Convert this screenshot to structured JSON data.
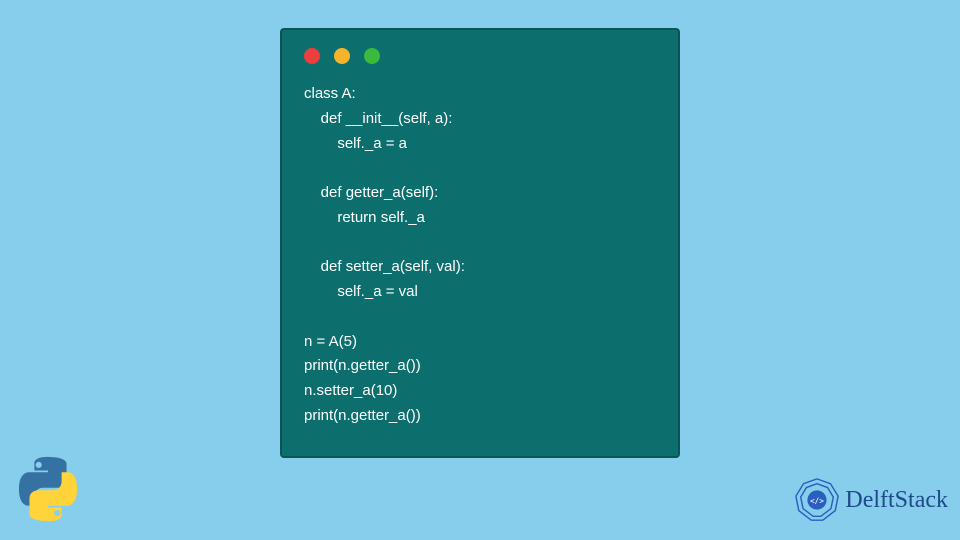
{
  "code": {
    "lines": [
      "class A:",
      "    def __init__(self, a):",
      "        self._a = a",
      "",
      "    def getter_a(self):",
      "        return self._a",
      "",
      "    def setter_a(self, val):",
      "        self._a = val",
      "",
      "n = A(5)",
      "print(n.getter_a())",
      "n.setter_a(10)",
      "print(n.getter_a())"
    ]
  },
  "brand": {
    "name": "DelftStack"
  }
}
